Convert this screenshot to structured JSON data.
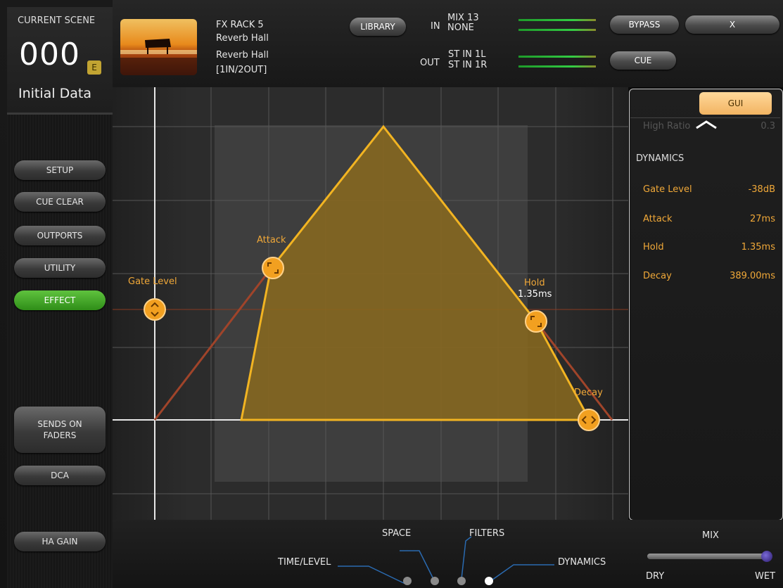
{
  "scene": {
    "label": "CURRENT SCENE",
    "number": "000",
    "badge": "E",
    "name": "Initial Data"
  },
  "left_buttons": {
    "setup": "SETUP",
    "cue_clear": "CUE CLEAR",
    "outports": "OUTPORTS",
    "utility": "UTILITY",
    "effect": "EFFECT",
    "sends_on_faders_line1": "SENDS ON",
    "sends_on_faders_line2": "FADERS",
    "dca": "DCA",
    "ha_gain": "HA GAIN"
  },
  "rack": {
    "title": "FX RACK 5",
    "type": "Reverb Hall",
    "preset": "Reverb Hall",
    "config": "[1IN/2OUT]"
  },
  "top": {
    "library": "LIBRARY",
    "in_label": "IN",
    "in_1": "MIX 13",
    "in_2": "NONE",
    "out_label": "OUT",
    "out_1": "ST IN 1L",
    "out_2": "ST IN 1R",
    "bypass": "BYPASS",
    "close": "X",
    "cue": "CUE"
  },
  "graph": {
    "gate_level_label": "Gate Level",
    "attack_label": "Attack",
    "hold_label": "Hold",
    "hold_value": "1.35ms",
    "decay_label": "Decay"
  },
  "panel": {
    "gui": "GUI",
    "prev_param": "High Ratio",
    "prev_value": "0.3",
    "section": "DYNAMICS",
    "params": [
      {
        "name": "Gate Level",
        "value": "-38dB"
      },
      {
        "name": "Attack",
        "value": "27ms"
      },
      {
        "name": "Hold",
        "value": "1.35ms"
      },
      {
        "name": "Decay",
        "value": "389.00ms"
      }
    ]
  },
  "bottom": {
    "time_level": "TIME/LEVEL",
    "space": "SPACE",
    "filters": "FILTERS",
    "dynamics": "DYNAMICS",
    "mix": "MIX",
    "dry": "DRY",
    "wet": "WET",
    "mix_value": 1.0
  },
  "colors": {
    "accent": "#f0a838",
    "effect_active": "#3fa824",
    "envelope_fill": "#8a6a1e",
    "envelope_line": "#f2b422",
    "gate_line": "#a0442a"
  }
}
